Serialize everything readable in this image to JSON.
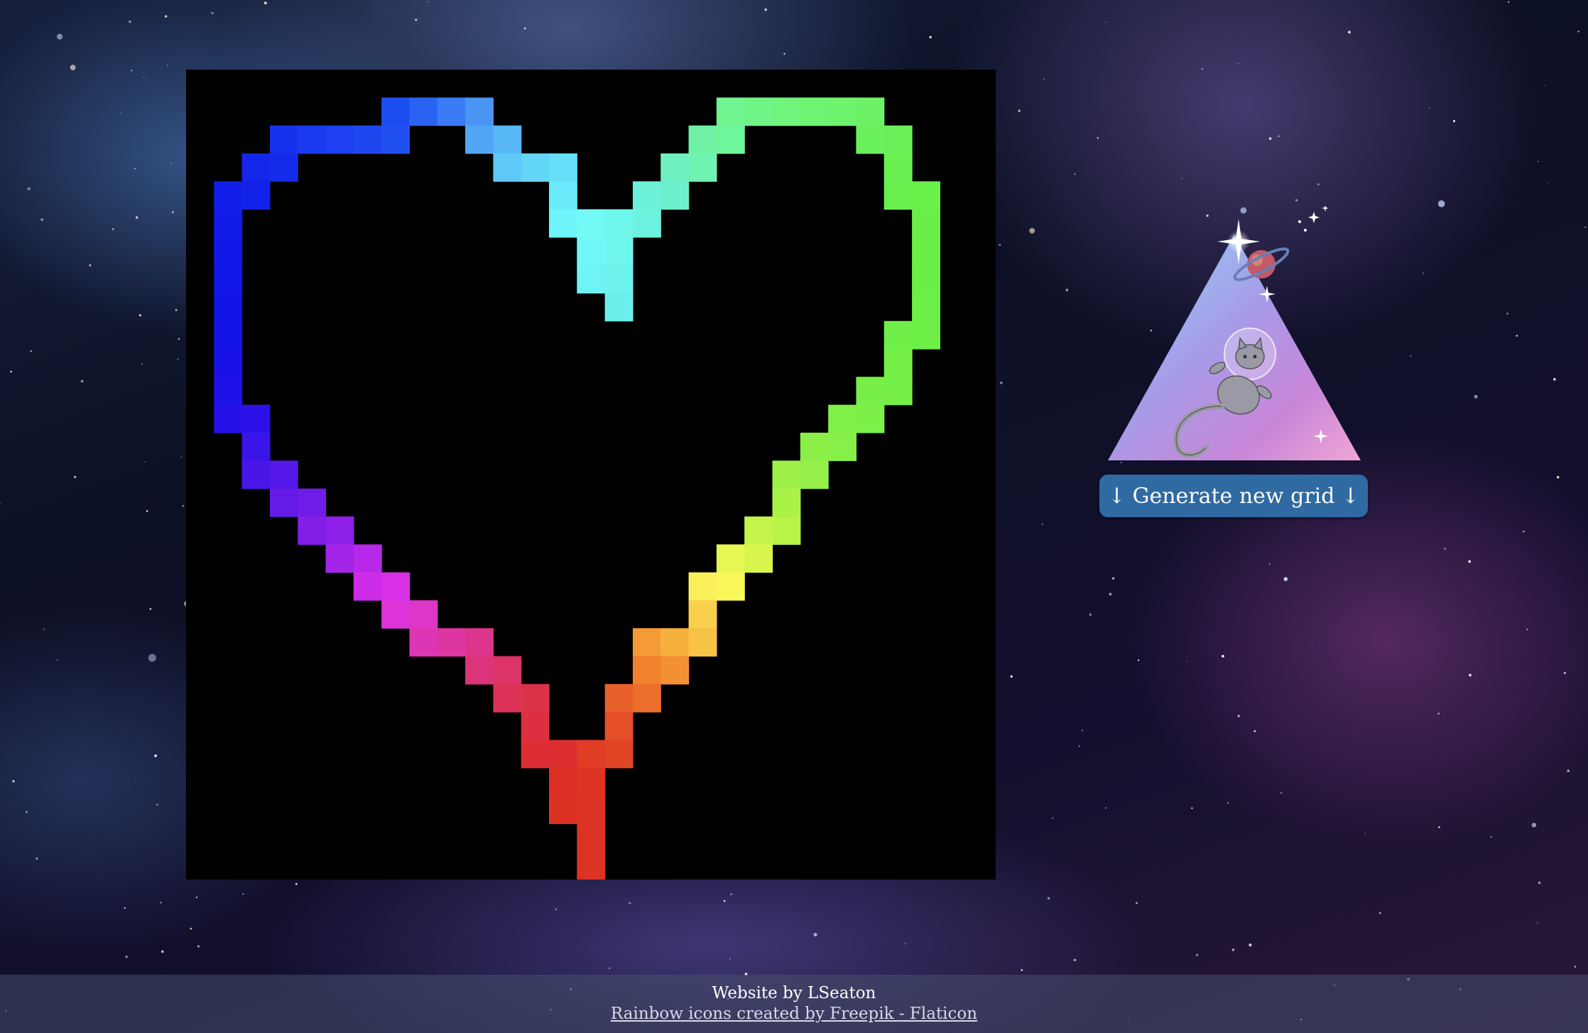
{
  "grid": {
    "cols": 29,
    "rows": 29,
    "background": "#000000",
    "pixels": [
      {
        "c": 7,
        "r": 1,
        "color": "#1c4df0"
      },
      {
        "c": 8,
        "r": 1,
        "color": "#2a63f2"
      },
      {
        "c": 9,
        "r": 1,
        "color": "#3a7cf3"
      },
      {
        "c": 10,
        "r": 1,
        "color": "#4a94f4"
      },
      {
        "c": 19,
        "r": 1,
        "color": "#6ef58f"
      },
      {
        "c": 20,
        "r": 1,
        "color": "#6ff585"
      },
      {
        "c": 21,
        "r": 1,
        "color": "#70f47c"
      },
      {
        "c": 22,
        "r": 1,
        "color": "#6ef473"
      },
      {
        "c": 23,
        "r": 1,
        "color": "#6df36c"
      },
      {
        "c": 24,
        "r": 1,
        "color": "#6df266"
      },
      {
        "c": 3,
        "r": 2,
        "color": "#1732ec"
      },
      {
        "c": 4,
        "r": 2,
        "color": "#1a3af0"
      },
      {
        "c": 5,
        "r": 2,
        "color": "#1d41f0"
      },
      {
        "c": 6,
        "r": 2,
        "color": "#1f47f0"
      },
      {
        "c": 7,
        "r": 2,
        "color": "#2150f1"
      },
      {
        "c": 10,
        "r": 2,
        "color": "#52a6f5"
      },
      {
        "c": 11,
        "r": 2,
        "color": "#58b8f6"
      },
      {
        "c": 18,
        "r": 2,
        "color": "#6ff2a6"
      },
      {
        "c": 19,
        "r": 2,
        "color": "#6ff59a"
      },
      {
        "c": 24,
        "r": 2,
        "color": "#6cf15e"
      },
      {
        "c": 25,
        "r": 2,
        "color": "#6cf05a"
      },
      {
        "c": 2,
        "r": 3,
        "color": "#1426ea"
      },
      {
        "c": 3,
        "r": 3,
        "color": "#152bea"
      },
      {
        "c": 11,
        "r": 3,
        "color": "#5ec8f7"
      },
      {
        "c": 12,
        "r": 3,
        "color": "#63d6f8"
      },
      {
        "c": 13,
        "r": 3,
        "color": "#66e0f9"
      },
      {
        "c": 17,
        "r": 3,
        "color": "#6ef0c0"
      },
      {
        "c": 18,
        "r": 3,
        "color": "#6ff2b2"
      },
      {
        "c": 25,
        "r": 3,
        "color": "#6bf054"
      },
      {
        "c": 1,
        "r": 4,
        "color": "#121fe8"
      },
      {
        "c": 2,
        "r": 4,
        "color": "#1322e8"
      },
      {
        "c": 13,
        "r": 4,
        "color": "#6aeafa"
      },
      {
        "c": 16,
        "r": 4,
        "color": "#6cf0d8"
      },
      {
        "c": 17,
        "r": 4,
        "color": "#6df0cc"
      },
      {
        "c": 25,
        "r": 4,
        "color": "#6af04e"
      },
      {
        "c": 26,
        "r": 4,
        "color": "#6af04a"
      },
      {
        "c": 1,
        "r": 5,
        "color": "#111ce8"
      },
      {
        "c": 13,
        "r": 5,
        "color": "#6ef4fb"
      },
      {
        "c": 14,
        "r": 5,
        "color": "#72fbf6"
      },
      {
        "c": 15,
        "r": 5,
        "color": "#6ff6ea"
      },
      {
        "c": 16,
        "r": 5,
        "color": "#6df2e0"
      },
      {
        "c": 26,
        "r": 5,
        "color": "#69ef48"
      },
      {
        "c": 1,
        "r": 6,
        "color": "#1119e8"
      },
      {
        "c": 14,
        "r": 6,
        "color": "#70f8f6"
      },
      {
        "c": 15,
        "r": 6,
        "color": "#6ff6ee"
      },
      {
        "c": 26,
        "r": 6,
        "color": "#69ef46"
      },
      {
        "c": 1,
        "r": 7,
        "color": "#1117e8"
      },
      {
        "c": 14,
        "r": 7,
        "color": "#6ff4f4"
      },
      {
        "c": 15,
        "r": 7,
        "color": "#6ef2ee"
      },
      {
        "c": 26,
        "r": 7,
        "color": "#6aef46"
      },
      {
        "c": 1,
        "r": 8,
        "color": "#1215e8"
      },
      {
        "c": 15,
        "r": 8,
        "color": "#6cefec"
      },
      {
        "c": 26,
        "r": 8,
        "color": "#6cef46"
      },
      {
        "c": 1,
        "r": 9,
        "color": "#1414e8"
      },
      {
        "c": 25,
        "r": 9,
        "color": "#6fef48"
      },
      {
        "c": 26,
        "r": 9,
        "color": "#6eef46"
      },
      {
        "c": 1,
        "r": 10,
        "color": "#1812e8"
      },
      {
        "c": 25,
        "r": 10,
        "color": "#73ef48"
      },
      {
        "c": 1,
        "r": 11,
        "color": "#1e12e8"
      },
      {
        "c": 24,
        "r": 11,
        "color": "#78ef48"
      },
      {
        "c": 25,
        "r": 11,
        "color": "#76ef48"
      },
      {
        "c": 1,
        "r": 12,
        "color": "#2612e8"
      },
      {
        "c": 2,
        "r": 12,
        "color": "#2c12e8"
      },
      {
        "c": 23,
        "r": 12,
        "color": "#80ef48"
      },
      {
        "c": 24,
        "r": 12,
        "color": "#7cef48"
      },
      {
        "c": 2,
        "r": 13,
        "color": "#3a14e8"
      },
      {
        "c": 22,
        "r": 13,
        "color": "#8cef48"
      },
      {
        "c": 23,
        "r": 13,
        "color": "#86ef48"
      },
      {
        "c": 2,
        "r": 14,
        "color": "#4a16e8"
      },
      {
        "c": 3,
        "r": 14,
        "color": "#5418e8"
      },
      {
        "c": 21,
        "r": 14,
        "color": "#9cf048"
      },
      {
        "c": 22,
        "r": 14,
        "color": "#94ef48"
      },
      {
        "c": 3,
        "r": 15,
        "color": "#661ae8"
      },
      {
        "c": 4,
        "r": 15,
        "color": "#701ce8"
      },
      {
        "c": 21,
        "r": 15,
        "color": "#aaf248"
      },
      {
        "c": 4,
        "r": 16,
        "color": "#821ee8"
      },
      {
        "c": 5,
        "r": 16,
        "color": "#8e20e8"
      },
      {
        "c": 20,
        "r": 16,
        "color": "#c4f44a"
      },
      {
        "c": 21,
        "r": 16,
        "color": "#b8f348"
      },
      {
        "c": 5,
        "r": 17,
        "color": "#a424e8"
      },
      {
        "c": 6,
        "r": 17,
        "color": "#b828e8"
      },
      {
        "c": 19,
        "r": 17,
        "color": "#e6f652"
      },
      {
        "c": 20,
        "r": 17,
        "color": "#d8f54e"
      },
      {
        "c": 6,
        "r": 18,
        "color": "#cc2ce8"
      },
      {
        "c": 7,
        "r": 18,
        "color": "#d830e4"
      },
      {
        "c": 18,
        "r": 18,
        "color": "#faf05a"
      },
      {
        "c": 19,
        "r": 18,
        "color": "#f8f85a"
      },
      {
        "c": 7,
        "r": 19,
        "color": "#dc34d8"
      },
      {
        "c": 8,
        "r": 19,
        "color": "#dd36c8"
      },
      {
        "c": 18,
        "r": 19,
        "color": "#f8d04e"
      },
      {
        "c": 8,
        "r": 20,
        "color": "#dd36b4"
      },
      {
        "c": 9,
        "r": 20,
        "color": "#dd36a0"
      },
      {
        "c": 10,
        "r": 20,
        "color": "#dc368c"
      },
      {
        "c": 16,
        "r": 20,
        "color": "#f49a36"
      },
      {
        "c": 17,
        "r": 20,
        "color": "#f6b03e"
      },
      {
        "c": 18,
        "r": 20,
        "color": "#f8c246"
      },
      {
        "c": 10,
        "r": 21,
        "color": "#dc3478"
      },
      {
        "c": 11,
        "r": 21,
        "color": "#dc3466"
      },
      {
        "c": 16,
        "r": 21,
        "color": "#f0822e"
      },
      {
        "c": 17,
        "r": 21,
        "color": "#f39034"
      },
      {
        "c": 11,
        "r": 22,
        "color": "#dc3258"
      },
      {
        "c": 12,
        "r": 22,
        "color": "#dc3248"
      },
      {
        "c": 15,
        "r": 22,
        "color": "#e8602a"
      },
      {
        "c": 16,
        "r": 22,
        "color": "#ec6e2c"
      },
      {
        "c": 12,
        "r": 23,
        "color": "#dc3040"
      },
      {
        "c": 15,
        "r": 23,
        "color": "#e44e28"
      },
      {
        "c": 12,
        "r": 24,
        "color": "#dc2e34"
      },
      {
        "c": 13,
        "r": 24,
        "color": "#dc2e2e"
      },
      {
        "c": 14,
        "r": 24,
        "color": "#e03c26"
      },
      {
        "c": 15,
        "r": 24,
        "color": "#e24426"
      },
      {
        "c": 13,
        "r": 25,
        "color": "#dc3026"
      },
      {
        "c": 14,
        "r": 25,
        "color": "#dd3424"
      },
      {
        "c": 13,
        "r": 26,
        "color": "#dc3224"
      },
      {
        "c": 14,
        "r": 26,
        "color": "#dc3424"
      },
      {
        "c": 14,
        "r": 27,
        "color": "#dc3424"
      },
      {
        "c": 14,
        "r": 28,
        "color": "#dc3424"
      }
    ]
  },
  "logo": {
    "icon": "space-cat-triangle-icon",
    "colors": [
      "#8fd6f5",
      "#a79be8",
      "#c986d8",
      "#f0a6d6"
    ]
  },
  "controls": {
    "generate_label": "↓ Generate new grid ↓",
    "button_color": "#2f6aa3"
  },
  "footer": {
    "credit": "Website by LSeaton",
    "attribution": "Rainbow icons created by Freepik - Flaticon"
  }
}
